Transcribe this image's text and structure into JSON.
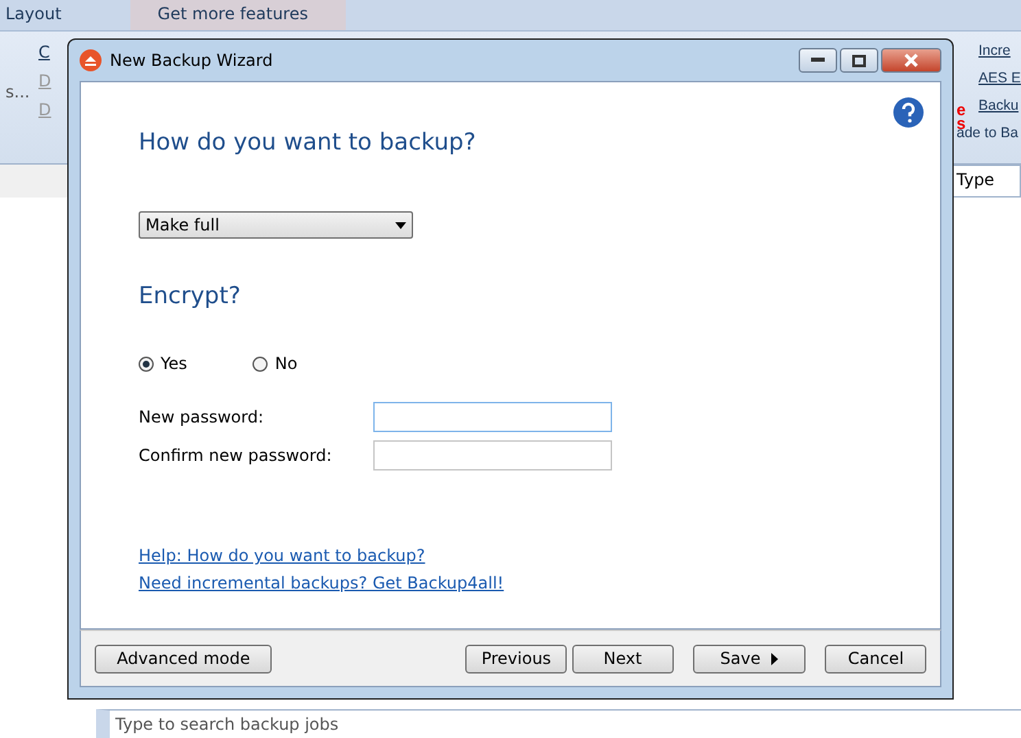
{
  "app": {
    "tabs": [
      {
        "label": "Layout",
        "selected": false
      },
      {
        "label": "Get more features",
        "selected": true
      }
    ],
    "ribbon_left": [
      {
        "label": "C",
        "disabled": false
      },
      {
        "label": "D",
        "disabled": true
      },
      {
        "label": "D",
        "disabled": true
      }
    ],
    "ribbon_left_caption": "s...",
    "ribbon_links": [
      "Incre",
      "AES E",
      "Backu"
    ],
    "ribbon_red": [
      "e",
      "s"
    ],
    "upgrade_text": "ade to Ba",
    "column": "Type",
    "search": {
      "placeholder": "Type to search backup jobs"
    }
  },
  "dialog": {
    "title": "New Backup Wizard",
    "heading": "How do you want to backup?",
    "backup_type": "Make full",
    "encrypt_heading": "Encrypt?",
    "options": [
      {
        "label": "Yes",
        "selected": true
      },
      {
        "label": "No",
        "selected": false
      }
    ],
    "fields": [
      {
        "label": "New password:",
        "focused": true
      },
      {
        "label": "Confirm new password:",
        "focused": false
      }
    ],
    "links": [
      "Help: How do you want to backup?",
      "Need incremental backups? Get Backup4all!"
    ],
    "buttons": [
      {
        "label": "Advanced mode",
        "kind": "plain"
      },
      {
        "label": "Previous",
        "kind": "plain"
      },
      {
        "label": "Next",
        "kind": "plain"
      },
      {
        "label": "Save",
        "kind": "menu"
      },
      {
        "label": "Cancel",
        "kind": "plain"
      }
    ]
  }
}
